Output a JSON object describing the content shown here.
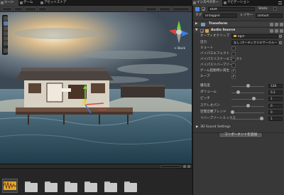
{
  "tabs": {
    "scene": "シーン",
    "game": "ゲーム",
    "asset_store": "アセットストア",
    "inspector": "インスペクター",
    "navigation": "ナビゲーション"
  },
  "scene": {
    "gizmo_label": "< Back"
  },
  "inspector": {
    "object_name": "BGM",
    "static_label": "Static",
    "tag_label": "タグ",
    "tag_value": "Untagged",
    "layer_label": "レイヤー",
    "layer_value": "Default",
    "transform_title": "Transform",
    "audio_source_title": "Audio Source",
    "audio_clip_label": "オーディオクリップ",
    "audio_clip_value": "bgm",
    "output_label": "出力",
    "output_value": "なし (オーディオミキサーグループ)",
    "mute_label": "ミュート",
    "bypass_effects_label": "バイパスエフェクト",
    "bypass_listener_label": "バイパスリスナーエフェクト",
    "bypass_reverb_label": "バイパスリバーブゾーン",
    "play_on_awake_label": "ゲーム起動時に再生",
    "loop_label": "ループ",
    "priority_label": "優先度",
    "priority_value": "128",
    "volume_label": "ボリューム",
    "volume_value": "0.2",
    "pitch_label": "ピッチ",
    "pitch_value": "1",
    "stereo_pan_label": "ステレオパン",
    "stereo_pan_value": "0",
    "spatial_blend_label": "空間音響ブレンド",
    "spatial_blend_value": "0",
    "reverb_zone_mix_label": "リバーブゾーンミックス",
    "reverb_zone_mix_value": "1",
    "sound_settings_label": "3D Sound Settings",
    "add_component_label": "コンポーネントを追加",
    "checkbox_states": {
      "mute": false,
      "bypass_effects": false,
      "bypass_listener": false,
      "bypass_reverb": false,
      "play_on_awake": true,
      "loop": true
    },
    "slider_levels": {
      "priority": 0.5,
      "volume": 0.2,
      "pitch": 0.67,
      "stereo_pan": 0.5,
      "spatial_blend": 0,
      "reverb_zone_mix": 0.9
    }
  },
  "colors": {
    "accent": "#4a8be0",
    "panel": "#383838",
    "scene_sky": "#5c6e7c"
  }
}
